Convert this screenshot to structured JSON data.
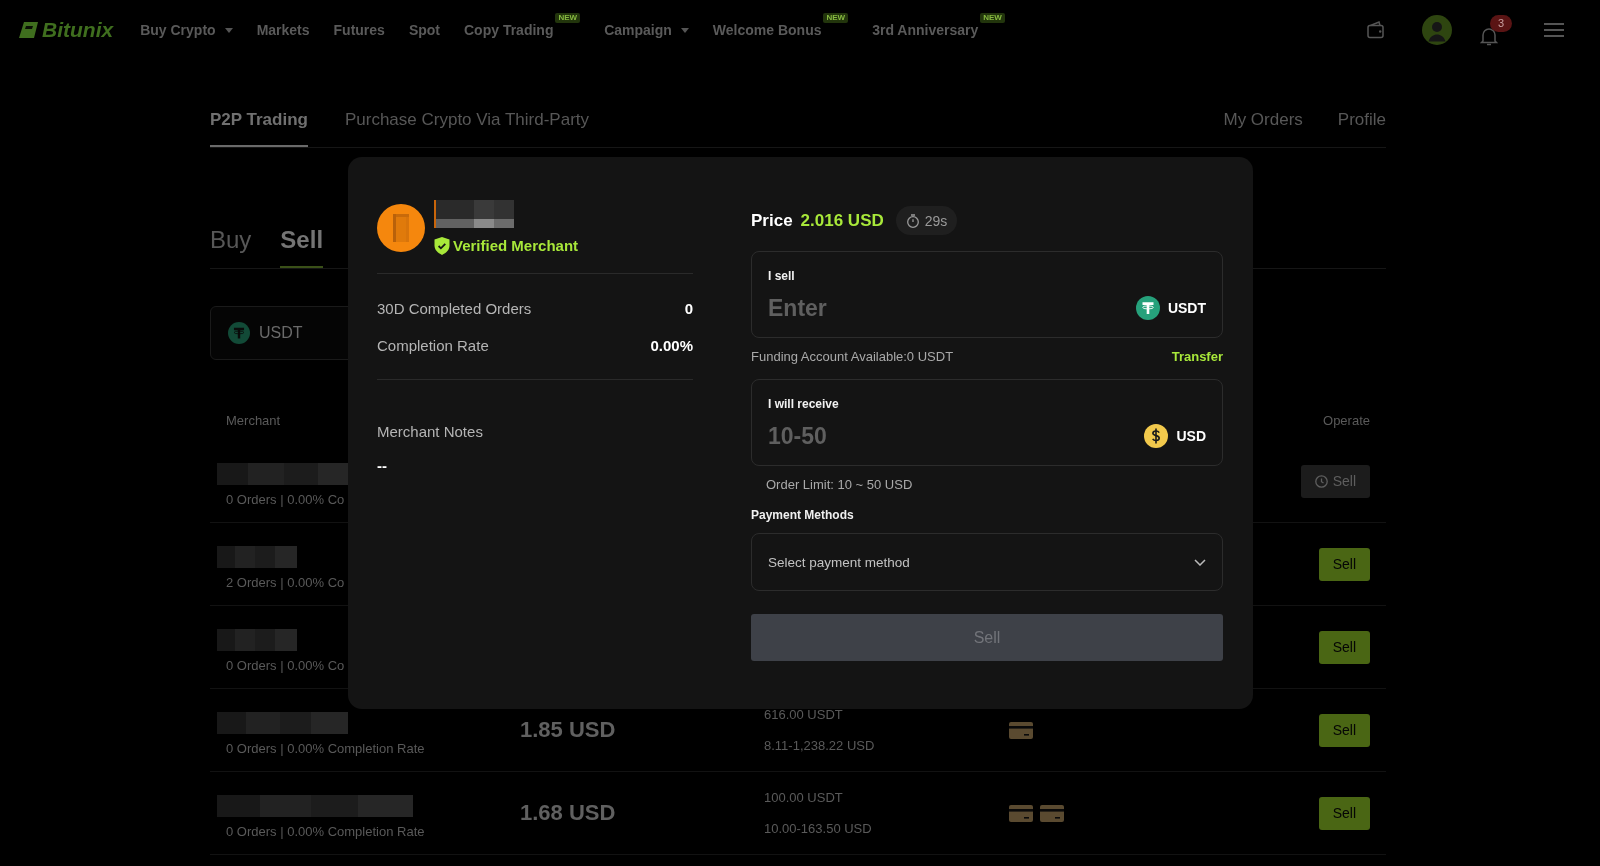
{
  "nav": {
    "brand": "Bitunix",
    "items": [
      {
        "label": "Buy Crypto",
        "dropdown": true
      },
      {
        "label": "Markets",
        "dropdown": false
      },
      {
        "label": "Futures",
        "dropdown": false
      },
      {
        "label": "Spot",
        "dropdown": false
      },
      {
        "label": "Copy Trading",
        "dropdown": false,
        "badge": "NEW"
      },
      {
        "label": "Campaign",
        "dropdown": true
      },
      {
        "label": "Welcome Bonus",
        "dropdown": false,
        "badge": "NEW"
      },
      {
        "label": "3rd Anniversary",
        "dropdown": false,
        "badge": "NEW"
      }
    ],
    "notification_count": "3"
  },
  "page_tabs": [
    {
      "label": "P2P Trading",
      "selected": true
    },
    {
      "label": "Purchase Crypto Via Third-Party",
      "selected": false
    }
  ],
  "page_links": [
    "My Orders",
    "Profile"
  ],
  "trade_tabs": [
    {
      "label": "Buy",
      "selected": false
    },
    {
      "label": "Sell",
      "selected": true
    }
  ],
  "asset_selector": {
    "value": "USDT"
  },
  "table": {
    "columns": [
      "Merchant",
      "Operate"
    ],
    "rows": [
      {
        "stats": "0 Orders | 0.00% Co",
        "action": "Sell",
        "disabled": true
      },
      {
        "stats": "2 Orders | 0.00% Co",
        "action": "Sell",
        "disabled": false
      },
      {
        "stats": "0 Orders | 0.00% Co",
        "action": "Sell",
        "disabled": false
      },
      {
        "stats": "0 Orders | 0.00% Completion Rate",
        "price": "1.85 USD",
        "available": "616.00 USDT",
        "limits": "8.11-1,238.22 USD",
        "payments": [
          {
            "kind": "card"
          }
        ],
        "action": "Sell",
        "disabled": false
      },
      {
        "stats": "0 Orders | 0.00% Completion Rate",
        "price": "1.68 USD",
        "available": "100.00 USDT",
        "limits": "10.00-163.50 USD",
        "payments": [
          {
            "kind": "card"
          },
          {
            "kind": "card"
          }
        ],
        "action": "Sell",
        "disabled": false
      }
    ]
  },
  "dialog": {
    "verified": "Verified Merchant",
    "stats": [
      {
        "label": "30D Completed Orders",
        "value": "0"
      },
      {
        "label": "Completion Rate",
        "value": "0.00%"
      }
    ],
    "notes_label": "Merchant Notes",
    "notes": "--",
    "price_label": "Price",
    "price": "2.016 USD",
    "timer": "29s",
    "fields": [
      {
        "label": "I sell",
        "placeholder": "Enter",
        "currency": "USDT"
      },
      {
        "label": "I will receive",
        "placeholder": "10-50",
        "currency": "USD"
      }
    ],
    "funding": "Funding Account Available:0 USDT",
    "transfer": "Transfer",
    "order_limit": "Order Limit: 10 ~ 50 USD",
    "payment_label": "Payment Methods",
    "payment_select": {
      "placeholder": "Select payment method"
    },
    "submit": {
      "label": "Sell",
      "disabled": true
    }
  }
}
